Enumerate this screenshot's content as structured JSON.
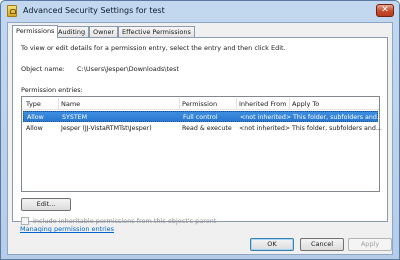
{
  "window": {
    "title": "Advanced Security Settings for test"
  },
  "tabs": [
    {
      "label": "Permissions",
      "active": true
    },
    {
      "label": "Auditing",
      "active": false
    },
    {
      "label": "Owner",
      "active": false
    },
    {
      "label": "Effective Permissions",
      "active": false
    }
  ],
  "permissions": {
    "instruction": "To view or edit details for a permission entry, select the entry and then click Edit.",
    "object_name_label": "Object name:",
    "object_name_value": "C:\\Users\\Jesper\\Downloads\\test",
    "entries_label": "Permission entries:",
    "columns": [
      "Type",
      "Name",
      "Permission",
      "Inherited From",
      "Apply To"
    ],
    "rows": [
      {
        "type": "Allow",
        "name": "SYSTEM",
        "permission": "Full control",
        "inherited_from": "<not inherited>",
        "apply_to": "This folder, subfolders and...",
        "selected": true
      },
      {
        "type": "Allow",
        "name": "Jesper (JJ-VistaRTMTst\\Jesper)",
        "permission": "Read & execute",
        "inherited_from": "<not inherited>",
        "apply_to": "This folder, subfolders and...",
        "selected": false
      }
    ],
    "edit_button": "Edit...",
    "include_inheritable_label": "Include inheritable permissions from this object's parent",
    "include_inheritable_checked": false,
    "manage_link": "Managing permission entries"
  },
  "footer": {
    "ok": "OK",
    "cancel": "Cancel",
    "apply": "Apply"
  }
}
